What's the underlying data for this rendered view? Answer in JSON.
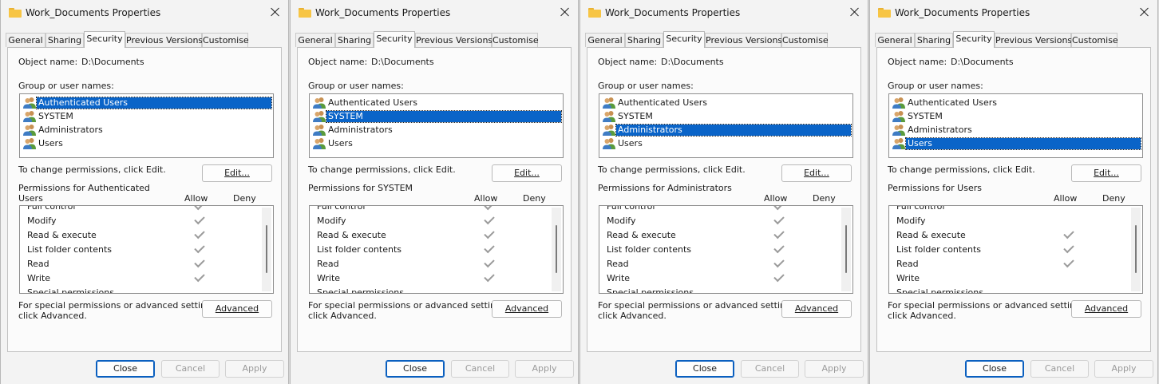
{
  "dialog_title": "Work_Documents Properties",
  "tabs": [
    "General",
    "Sharing",
    "Security",
    "Previous Versions",
    "Customise"
  ],
  "object_name_label": "Object name:",
  "object_name_value": "D:\\Documents",
  "group_label": "Group or user names:",
  "users": [
    "Authenticated Users",
    "SYSTEM",
    "Administrators",
    "Users"
  ],
  "change_hint": "To change permissions, click Edit.",
  "edit_button": "Edit...",
  "allow_header": "Allow",
  "deny_header": "Deny",
  "permissions": [
    "Full control",
    "Modify",
    "Read & execute",
    "List folder contents",
    "Read",
    "Write",
    "Special permissions"
  ],
  "advanced_hint_line1": "For special permissions or advanced settings,",
  "advanced_hint_line2": "click Advanced.",
  "advanced_button": "Advanced",
  "close_button": "Close",
  "cancel_button": "Cancel",
  "apply_button": "Apply",
  "dialogs": [
    {
      "perm_title_line1": "Permissions for Authenticated",
      "perm_title_line2": "Users",
      "selected_user": 0,
      "allow": [
        true,
        true,
        true,
        true,
        true,
        true,
        false
      ]
    },
    {
      "perm_title_line1": "Permissions for SYSTEM",
      "perm_title_line2": "",
      "selected_user": 1,
      "allow": [
        true,
        true,
        true,
        true,
        true,
        true,
        false
      ]
    },
    {
      "perm_title_line1": "Permissions for Administrators",
      "perm_title_line2": "",
      "selected_user": 2,
      "allow": [
        true,
        true,
        true,
        true,
        true,
        true,
        false
      ]
    },
    {
      "perm_title_line1": "Permissions for Users",
      "perm_title_line2": "",
      "selected_user": 3,
      "allow": [
        false,
        false,
        true,
        true,
        true,
        false,
        false
      ]
    }
  ],
  "colors": {
    "selection": "#0a64c8",
    "window_bg": "#f3f3f3",
    "check": "#9b9b9b"
  }
}
